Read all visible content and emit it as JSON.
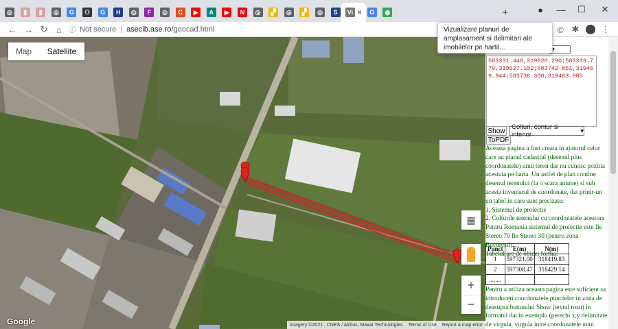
{
  "browser": {
    "tabs": [
      {
        "icon": "tab-icon-generic",
        "color": "#5f6368",
        "glyph": "◎"
      },
      {
        "icon": "tab-icon-doc",
        "color": "#e0a0a0",
        "glyph": "▮"
      },
      {
        "icon": "tab-icon-doc",
        "color": "#e0a0a0",
        "glyph": "▮"
      },
      {
        "icon": "tab-icon-generic",
        "color": "#5f6368",
        "glyph": "◎"
      },
      {
        "icon": "tab-icon-google",
        "color": "#4285f4",
        "glyph": "G"
      },
      {
        "icon": "tab-icon-person",
        "color": "#333333",
        "glyph": "⚇"
      },
      {
        "icon": "tab-icon-google",
        "color": "#4285f4",
        "glyph": "G"
      },
      {
        "icon": "tab-icon-h",
        "color": "#1a3c8c",
        "glyph": "H"
      },
      {
        "icon": "tab-icon-generic",
        "color": "#5f6368",
        "glyph": "◎"
      },
      {
        "icon": "tab-icon-f",
        "color": "#8e24aa",
        "glyph": "F"
      },
      {
        "icon": "tab-icon-generic",
        "color": "#5f6368",
        "glyph": "◎"
      },
      {
        "icon": "tab-icon-c",
        "color": "#e64a19",
        "glyph": "C"
      },
      {
        "icon": "tab-icon-youtube",
        "color": "#ff0000",
        "glyph": "▶"
      },
      {
        "icon": "tab-icon-a",
        "color": "#00897b",
        "glyph": "A"
      },
      {
        "icon": "tab-icon-youtube",
        "color": "#ff0000",
        "glyph": "▶"
      },
      {
        "icon": "tab-icon-netflix",
        "color": "#e50914",
        "glyph": "N"
      },
      {
        "icon": "tab-icon-generic",
        "color": "#5f6368",
        "glyph": "◎"
      },
      {
        "icon": "tab-icon-chart",
        "color": "#f2b900",
        "glyph": "▞"
      },
      {
        "icon": "tab-icon-generic",
        "color": "#5f6368",
        "glyph": "◎"
      },
      {
        "icon": "tab-icon-chart",
        "color": "#f2b900",
        "glyph": "▞"
      },
      {
        "icon": "tab-icon-generic",
        "color": "#5f6368",
        "glyph": "◎"
      },
      {
        "icon": "tab-icon-s",
        "color": "#1c4587",
        "glyph": "S"
      },
      {
        "icon": "tab-icon-vi",
        "color": "#777777",
        "glyph": "Vi",
        "active": true
      },
      {
        "icon": "tab-icon-google",
        "color": "#4285f4",
        "glyph": "G"
      },
      {
        "icon": "tab-icon-maps",
        "color": "#34a853",
        "glyph": "◉"
      }
    ],
    "new_tab": "+",
    "url_insecure": "Not secure",
    "url_separator": "|",
    "url_host": "asecib.ase.ro",
    "url_path": "/goocad.html",
    "tooltip_title": "Vizualizare planuri de amplasament si delimitari ale imobilelor pe hartil...",
    "tooltip_host": "asecib.ase.ro"
  },
  "map": {
    "map_label": "Map",
    "satellite_label": "Satellite",
    "google_logo": "Google",
    "attribution": "Imagery ©2021 , CNES / Airbus, Maxar Technologies",
    "terms": "Terms of Use",
    "report": "Report a map error",
    "zoom_in": "+",
    "zoom_out": "−"
  },
  "panel": {
    "coords_text": "583331.448,319620.290;583333.779,319627.102;583742.851,319469.944;583738.300,319463.985",
    "show_label": "Show",
    "mode_select": "Colturi, contur si interior",
    "topdf_label": "ToPDF",
    "description": "Aceasta pagina a fost creata in ajutorul celor care au planul cadastral (desenul plus coordonatele) unui teren dar nu cunosc pozitia acestuia pe harta. Un astfel de plan contine desenul terenului (la o scara anume) si sub acesta inventarul de coordonate, dat printr-un un tabel in care sunt precizate:",
    "item1": "1. Sistemul de proiectie",
    "item2": "2. Colturile terenului cu coordonatele acestora",
    "item3": "Pentru Romania sistemul de proiectie este fie Stereo 70 fie Stereo 30 (pentru zona Bucuresti).",
    "item4": "Tabelul are de obicei forma:",
    "table_headers": [
      "Punct",
      "E(m)",
      "N(m)"
    ],
    "table_rows": [
      [
        "1",
        "597321.00",
        "318419.83"
      ],
      [
        "2",
        "597308.47",
        "318429.14"
      ],
      [
        "........",
        "",
        ""
      ]
    ],
    "description2": "Pentru a utiliza aceasta pagina este suficient sa introduceti coordonatele punctelor in zona de deasupra butonului Show (textul rosu) in formatul dat in exemplu (perechi x,y delimitate de virgula, virgula intre coordonatele unui punct si ; intre"
  },
  "colors": {
    "desc_text": "#006400",
    "coords_text": "#b22222",
    "polygon": "#e02020"
  }
}
